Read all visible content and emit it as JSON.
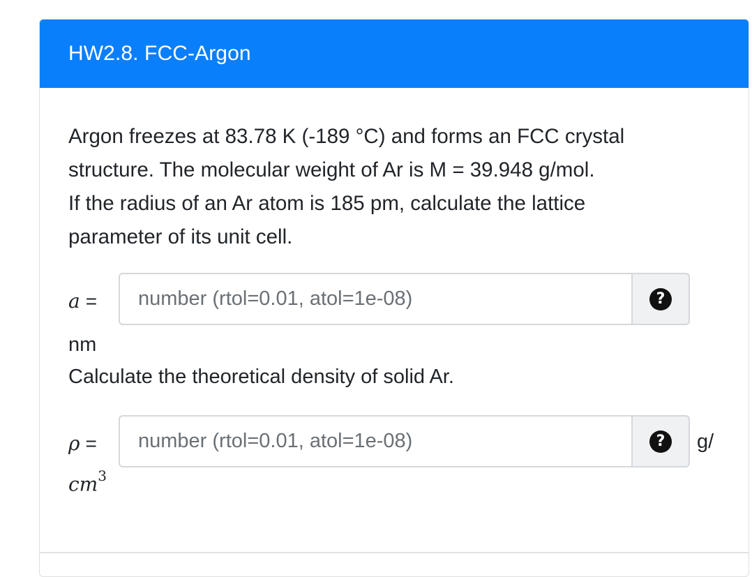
{
  "header": {
    "title": "HW2.8. FCC-Argon"
  },
  "question": {
    "line1": "Argon freezes at 83.78 K (-189 °C) and forms an FCC crystal",
    "line2": "structure. The molecular weight of Ar is M = 39.948 g/mol.",
    "line3": "If the radius of an Ar atom is 185 pm, calculate the lattice",
    "line4": "parameter of its unit cell."
  },
  "part1": {
    "variable": "a",
    "equals": "=",
    "placeholder": "number (rtol=0.01, atol=1e-08)",
    "value": "",
    "help_icon": "question-circle-icon",
    "unit": "nm"
  },
  "part2": {
    "prompt": "Calculate the theoretical density of solid Ar.",
    "variable": "ρ",
    "equals": "=",
    "placeholder": "number (rtol=0.01, atol=1e-08)",
    "value": "",
    "help_icon": "question-circle-icon",
    "unit_prefix": "g/",
    "unit_base": "cm",
    "unit_exp": "3"
  },
  "colors": {
    "header_bg": "#0a7ffb",
    "header_text": "#ffffff",
    "help_bg": "#eff1f3"
  }
}
